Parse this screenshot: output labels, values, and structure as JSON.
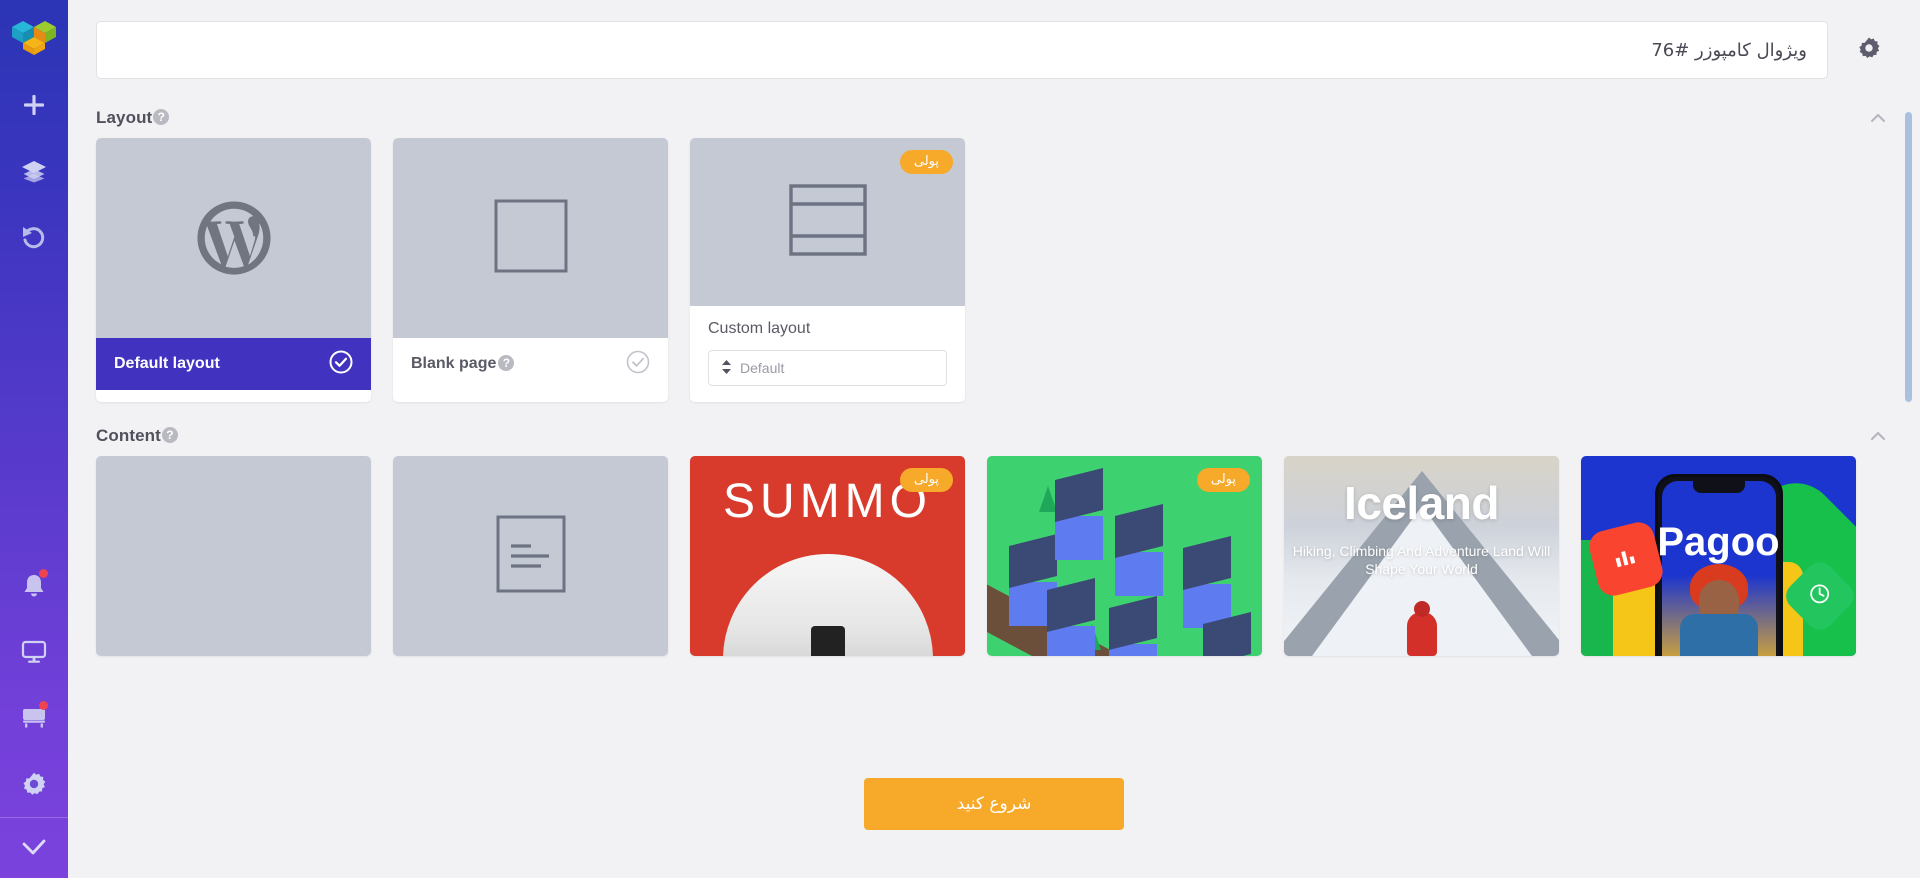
{
  "sidebar": {
    "logo": "visual-composer-cubes-logo",
    "items": [
      {
        "name": "add",
        "icon": "plus-icon"
      },
      {
        "name": "layers",
        "icon": "layers-icon"
      },
      {
        "name": "undo",
        "icon": "undo-icon"
      }
    ],
    "bottom_items": [
      {
        "name": "notifications",
        "icon": "bell-icon",
        "badge": true
      },
      {
        "name": "preview",
        "icon": "monitor-icon",
        "badge": false
      },
      {
        "name": "hub",
        "icon": "hub-icon",
        "badge": true
      },
      {
        "name": "settings",
        "icon": "gear-icon",
        "badge": false
      }
    ],
    "footer_item": {
      "name": "apply",
      "icon": "check-icon"
    }
  },
  "topbar": {
    "title_value": "ویژوال کامپوزر #76",
    "title_placeholder": "ویژوال کامپوزر #76",
    "settings_icon": "gear-icon"
  },
  "sections": {
    "layout": {
      "title": "Layout",
      "help": "?",
      "collapse_icon": "chevron-up-icon",
      "cards": [
        {
          "label": "Default layout",
          "thumb": "wordpress-logo",
          "selected": true,
          "has_help": false,
          "badge": null
        },
        {
          "label": "Blank page",
          "thumb": "empty-square",
          "selected": false,
          "has_help": true,
          "help": "?",
          "badge": null
        },
        {
          "label": "Custom layout",
          "thumb": "header-body-footer",
          "selected": false,
          "has_help": false,
          "badge": "پولی",
          "select_value": "Default"
        }
      ]
    },
    "content": {
      "title": "Content",
      "help": "?",
      "collapse_icon": "chevron-up-icon",
      "cards": [
        {
          "name": "blank-content",
          "thumb": "blank",
          "badge": null,
          "title": "",
          "subtitle": ""
        },
        {
          "name": "text-block-content",
          "thumb": "document-lines",
          "badge": null,
          "title": "",
          "subtitle": ""
        },
        {
          "name": "summo-template",
          "thumb": "summo-helmet",
          "badge": "پولی",
          "title": "SUMMO",
          "subtitle": ""
        },
        {
          "name": "houses-template",
          "thumb": "isometric-houses",
          "badge": "پولی",
          "title": "",
          "subtitle": ""
        },
        {
          "name": "iceland-template",
          "thumb": "iceland-mountain",
          "badge": null,
          "title": "Iceland",
          "subtitle": "Hiking, Climbing And Adventure Land Will Shape Your World"
        },
        {
          "name": "pagoo-template",
          "thumb": "pagoo-phone",
          "badge": null,
          "title": "Pagoo",
          "subtitle": ""
        }
      ]
    }
  },
  "footer": {
    "start_button": "شروع کنید"
  },
  "colors": {
    "accent_orange": "#f7a929",
    "selected_purple": "#4132bf",
    "sidebar_top": "#2b35b5",
    "sidebar_bottom": "#7b42dd",
    "thumb_gray": "#c5c9d4",
    "page_bg": "#f2f2f4"
  }
}
